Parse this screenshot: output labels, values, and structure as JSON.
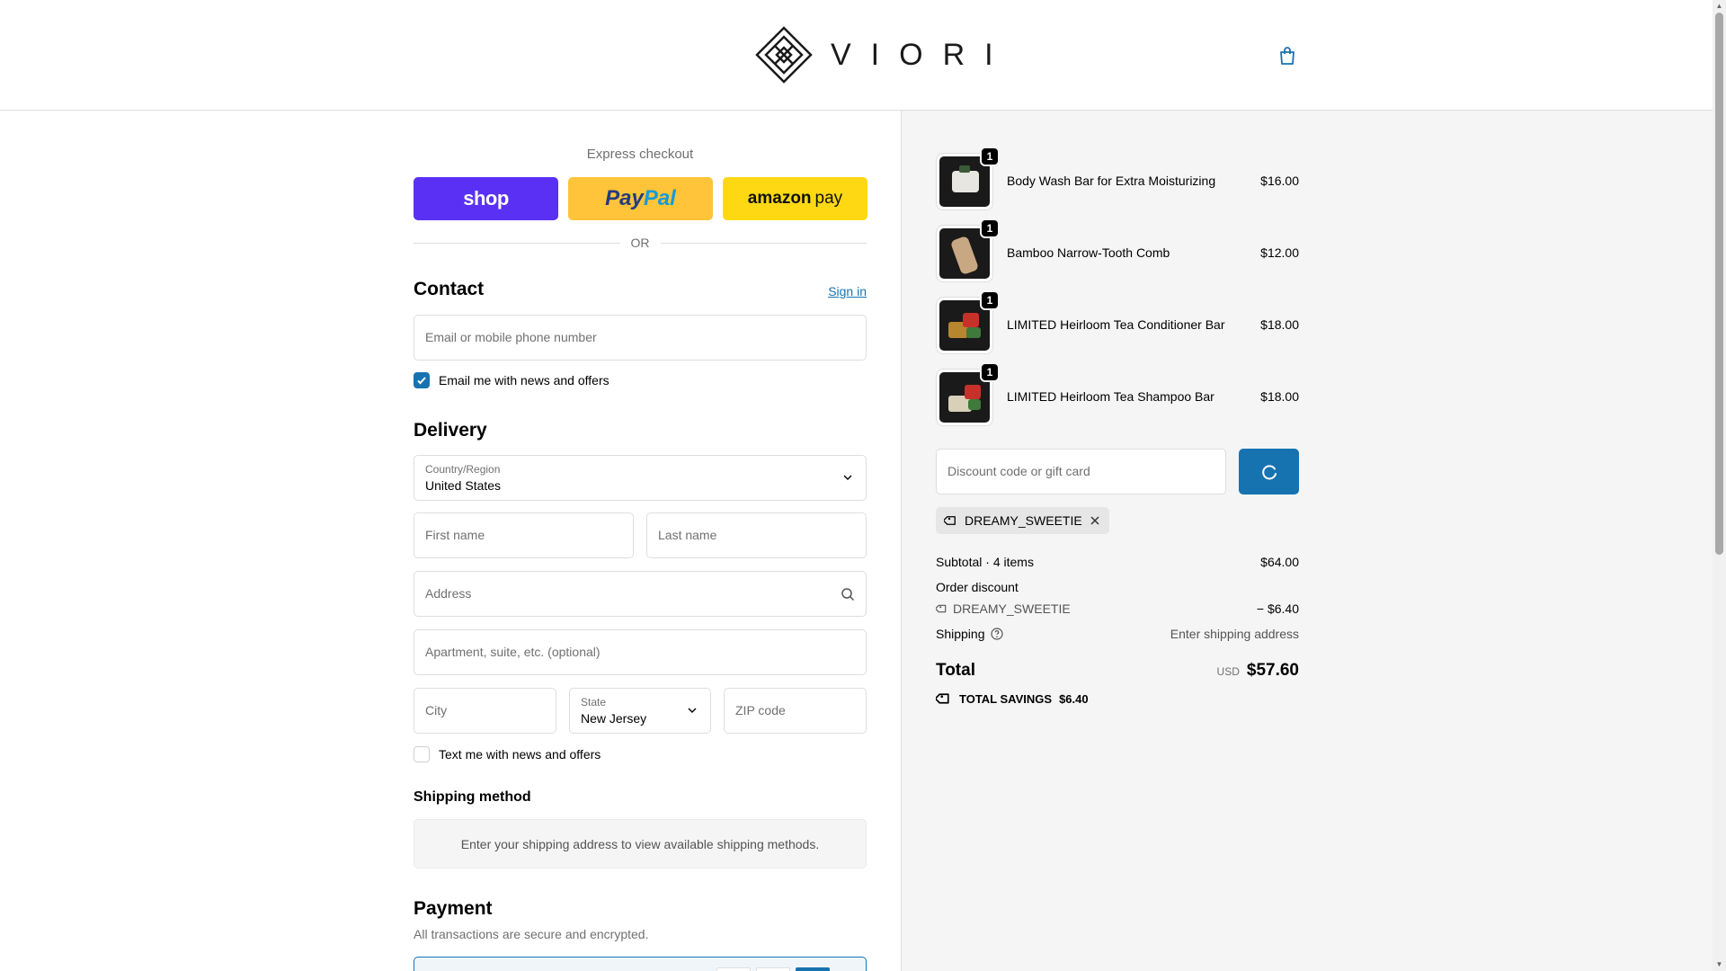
{
  "brand": {
    "name": "VIORI"
  },
  "express": {
    "label": "Express checkout",
    "shop": "shop",
    "paypal_a": "Pay",
    "paypal_b": "Pal",
    "amazon_a": "amazon",
    "amazon_b": "pay",
    "or": "OR"
  },
  "contact": {
    "title": "Contact",
    "sign_in": "Sign in",
    "email_placeholder": "Email or mobile phone number",
    "email_opt_in": "Email me with news and offers",
    "email_opt_in_checked": true
  },
  "delivery": {
    "title": "Delivery",
    "country_label": "Country/Region",
    "country_value": "United States",
    "first_name": "First name",
    "last_name": "Last name",
    "address": "Address",
    "apartment": "Apartment, suite, etc. (optional)",
    "city": "City",
    "state_label": "State",
    "state_value": "New Jersey",
    "zip": "ZIP code",
    "text_opt_in": "Text me with news and offers",
    "text_opt_in_checked": false
  },
  "shipping_method": {
    "title": "Shipping method",
    "message": "Enter your shipping address to view available shipping methods."
  },
  "payment": {
    "title": "Payment",
    "subtitle": "All transactions are secure and encrypted."
  },
  "order": {
    "items": [
      {
        "name": "Body Wash Bar for Extra Moisturizing",
        "price": "$16.00",
        "qty": "1"
      },
      {
        "name": "Bamboo Narrow-Tooth Comb",
        "price": "$12.00",
        "qty": "1"
      },
      {
        "name": "LIMITED Heirloom Tea Conditioner Bar",
        "price": "$18.00",
        "qty": "1"
      },
      {
        "name": "LIMITED Heirloom Tea Shampoo Bar",
        "price": "$18.00",
        "qty": "1"
      }
    ],
    "discount_placeholder": "Discount code or gift card",
    "applied_code": "DREAMY_SWEETIE",
    "subtotal_label": "Subtotal · 4 items",
    "subtotal_value": "$64.00",
    "order_discount_label": "Order discount",
    "discount_code_line": "DREAMY_SWEETIE",
    "discount_value": "− $6.40",
    "shipping_label": "Shipping",
    "shipping_value": "Enter shipping address",
    "total_label": "Total",
    "total_currency": "USD",
    "total_value": "$57.60",
    "savings_label": "TOTAL SAVINGS",
    "savings_value": "$6.40"
  },
  "colors": {
    "accent": "#1773b0",
    "shop_pay": "#5a31f4",
    "paypal": "#ffc439",
    "amazon_pay": "#ffd814"
  }
}
